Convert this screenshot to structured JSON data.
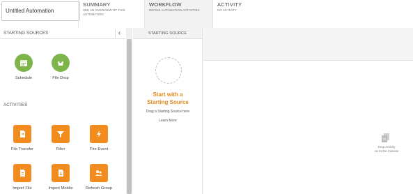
{
  "header": {
    "automation_name": "Untitled Automation",
    "tabs": [
      {
        "title": "SUMMARY",
        "subtitle": "SEE AN OVERVIEW OF THIS AUTOMATION"
      },
      {
        "title": "WORKFLOW",
        "subtitle": "DEFINE AUTOMATION ACTIVITIES"
      },
      {
        "title": "ACTIVITY",
        "subtitle": "NO ACTIVITY"
      }
    ]
  },
  "palette": {
    "starting_sources_title": "STARTING SOURCES",
    "collapse_icon": "‹",
    "sources": [
      {
        "label": "Schedule",
        "icon": "calendar-icon"
      },
      {
        "label": "File Drop",
        "icon": "file-drop-icon"
      }
    ],
    "activities_title": "ACTIVITIES",
    "activities": [
      {
        "label": "File Transfer",
        "icon": "file-transfer-icon"
      },
      {
        "label": "Filter",
        "icon": "filter-icon"
      },
      {
        "label": "Fire Event",
        "icon": "fire-event-icon"
      },
      {
        "label": "Import File",
        "icon": "import-file-icon"
      },
      {
        "label": "Import Mobile",
        "icon": "import-mobile-icon"
      },
      {
        "label": "Refresh Group",
        "icon": "refresh-group-icon"
      }
    ]
  },
  "source_column": {
    "header": "STARTING SOURCE",
    "title_line1": "Start with a",
    "title_line2": "Starting Source",
    "subtitle": "Drag a Starting Source here",
    "learn_more": "Learn More"
  },
  "canvas": {
    "drop_line1": "Drop Activity",
    "drop_line2": "on to the Canvas"
  },
  "colors": {
    "source_green": "#7db54a",
    "activity_orange": "#f28c1e",
    "accent_orange_text": "#e0891b"
  }
}
